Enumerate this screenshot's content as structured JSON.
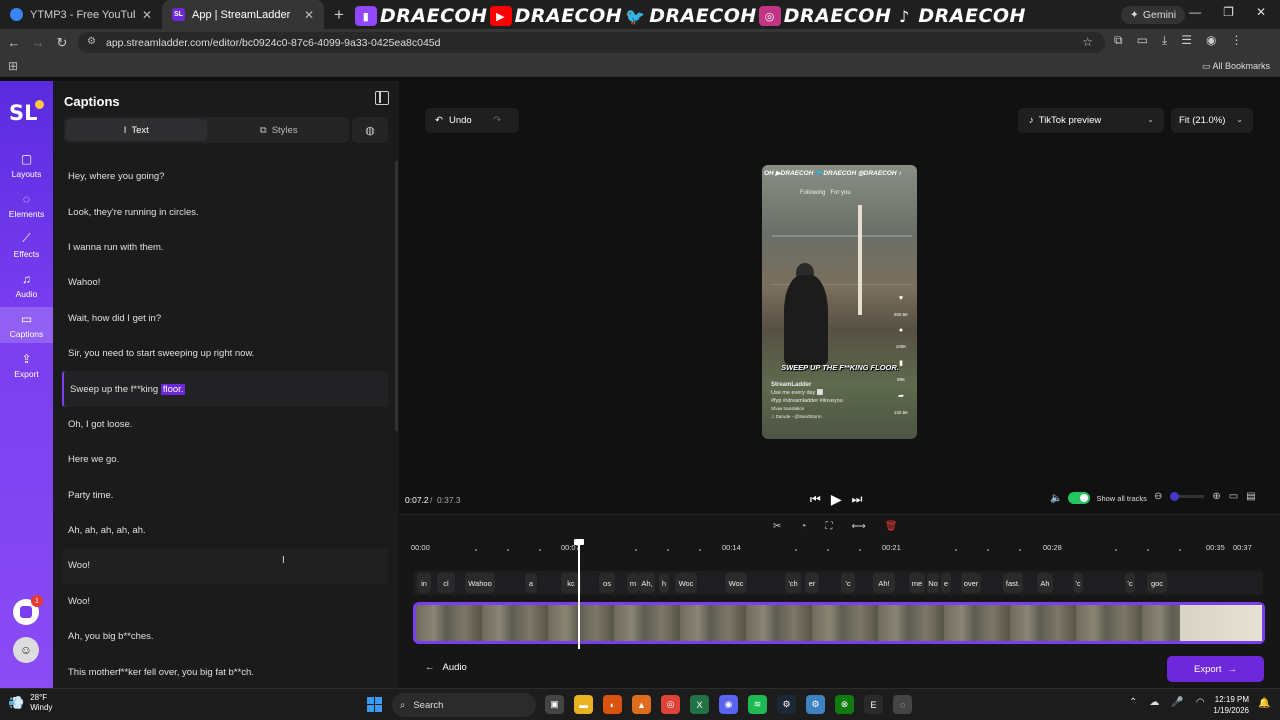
{
  "browser": {
    "tabs": [
      {
        "title": "YTMP3 - Free YouTube to MP3"
      },
      {
        "title": "App | StreamLadder",
        "favicon": "SL"
      }
    ],
    "new_tab": "+",
    "banner": {
      "handle": "DRAECOH",
      "platforms": [
        "twitch-icon",
        "youtube-icon",
        "twitter-icon",
        "instagram-icon",
        "tiktok-icon"
      ]
    },
    "gemini_label": "Gemini",
    "url": "app.streamladder.com/editor/bc0924c0-87c6-4099-9a33-0425ea8c045d",
    "all_bookmarks": "All Bookmarks"
  },
  "app": {
    "logo": "SL",
    "nav": [
      {
        "label": "Layouts",
        "icon": "square-icon"
      },
      {
        "label": "Elements",
        "icon": "shapes-icon"
      },
      {
        "label": "Effects",
        "icon": "wand-icon"
      },
      {
        "label": "Audio",
        "icon": "music-icon"
      },
      {
        "label": "Captions",
        "icon": "captions-icon"
      },
      {
        "label": "Export",
        "icon": "export-icon"
      }
    ],
    "notification_count": "1",
    "panel": {
      "title": "Captions",
      "tabs": {
        "text": "Text",
        "styles": "Styles"
      },
      "captions": [
        {
          "text": "Hey, where you going?"
        },
        {
          "text": "Look, they're running in circles."
        },
        {
          "text": "I wanna run with them."
        },
        {
          "text": "Wahoo!"
        },
        {
          "text": "Wait, how did I get in?"
        },
        {
          "text": "Sir, you need to start sweeping up right now."
        },
        {
          "text": "Sweep up the f**king ",
          "highlight": "floor."
        },
        {
          "text": "Oh, I got loose."
        },
        {
          "text": "Here we go."
        },
        {
          "text": "Party time."
        },
        {
          "text": "Ah, ah, ah, ah, ah."
        },
        {
          "text": "Woo!"
        },
        {
          "text": "Woo!"
        },
        {
          "text": "Ah, you big b**ches."
        },
        {
          "text": "This motherf**ker fell over, you big fat b**ch."
        }
      ]
    },
    "editor": {
      "undo": "Undo",
      "preview_mode": "TikTok preview",
      "fit": "Fit (21.0%)",
      "phone": {
        "banner": "OH ▶DRAECOH 🐦DRAECOH ◎DRAECOH ♪",
        "feed_tabs": "Following   For you",
        "caption": "SWEEP UP THE F**KING FLOOR.",
        "account": "StreamLadder",
        "desc": "Use me every day ⬜",
        "tags": "#fyp #streamladder #iloveyou",
        "translation": "Show translation",
        "sound": "♫ Darude - @SandStorm",
        "counts": [
          "250.5K",
          "100K",
          "89K",
          "132.5K"
        ]
      },
      "time_current": "0:07.2",
      "time_separator": "/",
      "time_total": "0:37.3",
      "show_all_tracks": "Show all tracks",
      "ruler": [
        "00:00",
        "00:07",
        "00:14",
        "00:21",
        "00:28",
        "00:35",
        "00:37"
      ],
      "caption_chips": [
        "in",
        "cl",
        "Wahoo",
        "a",
        "kc",
        "os",
        "m",
        "Ah,",
        "h",
        "Woc",
        "Woc",
        "'ch",
        "er",
        "'c",
        "Ah!",
        "me",
        "No",
        "e",
        "over",
        "fast.",
        "Ah",
        "'c",
        "'c",
        "goc"
      ],
      "audio": "Audio",
      "export": "Export"
    }
  },
  "taskbar": {
    "temp": "28°F",
    "weather": "Windy",
    "search": "Search",
    "time": "12:19 PM",
    "date": "1/19/2026"
  }
}
